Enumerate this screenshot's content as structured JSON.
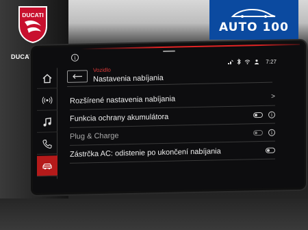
{
  "overlay": {
    "ducati_label": "DUCATI PREŠOV",
    "ducati_logo_text": "DUCATI",
    "auto100_text": "AUTO 100",
    "brand_colors": {
      "ducati_red": "#c8102e",
      "auto100_blue": "#0b4aa0"
    }
  },
  "status_bar": {
    "info_icon": "i",
    "icons": [
      "phone-signal-icon",
      "bluetooth-icon",
      "wireless-icon",
      "user-icon"
    ],
    "time": "7:27"
  },
  "rail": {
    "items": [
      {
        "icon": "home-icon",
        "active": false
      },
      {
        "icon": "broadcast-icon",
        "active": false
      },
      {
        "icon": "music-icon",
        "active": false
      },
      {
        "icon": "phone-icon",
        "active": false
      },
      {
        "icon": "car-icon",
        "active": true
      }
    ],
    "accent": "#b51a1a"
  },
  "header": {
    "breadcrumb": "Vozidlo",
    "title": "Nastavenia nabíjania"
  },
  "list": [
    {
      "label": "Rozšírené nastavenia nabíjania",
      "control": "chevron",
      "chevron": ">"
    },
    {
      "label": "Funkcia ochrany akumulátora",
      "control": "toggle+info",
      "info": "i"
    },
    {
      "label": "Plug & Charge",
      "control": "toggle+info",
      "info": "i",
      "disabled": true
    },
    {
      "label": "Zástrčka AC: odistenie po ukončení nabíjania",
      "control": "toggle"
    }
  ]
}
